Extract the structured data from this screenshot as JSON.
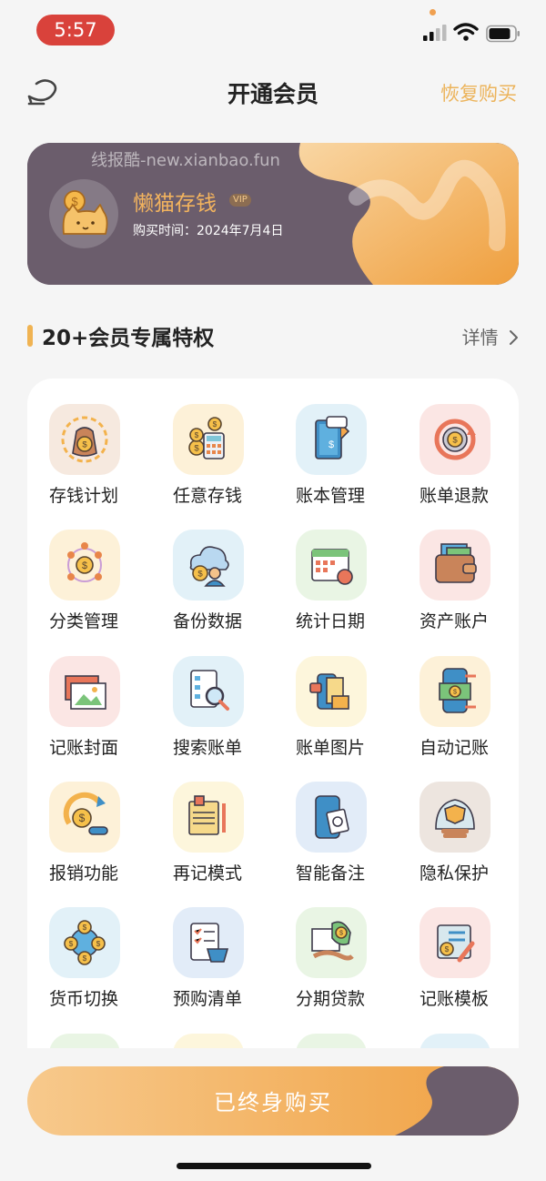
{
  "status_bar": {
    "time": "5:57"
  },
  "nav": {
    "title": "开通会员",
    "restore_label": "恢复购买"
  },
  "member_card": {
    "watermark": "线报酷-new.xianbao.fun",
    "name": "懒猫存钱",
    "vip_badge": "VIP",
    "purchase_time": "购买时间：2024年7月4日"
  },
  "section": {
    "title": "20+会员专属特权",
    "details_label": "详情"
  },
  "features": [
    {
      "label": "存钱计划",
      "icon": "money-bag-icon",
      "bg": "#f6e9df"
    },
    {
      "label": "任意存钱",
      "icon": "coins-calculator-icon",
      "bg": "#fdf1d8"
    },
    {
      "label": "账本管理",
      "icon": "ledger-book-icon",
      "bg": "#e2f1f8"
    },
    {
      "label": "账单退款",
      "icon": "refund-cycle-icon",
      "bg": "#fbe6e4"
    },
    {
      "label": "分类管理",
      "icon": "category-network-icon",
      "bg": "#fdf1d8"
    },
    {
      "label": "备份数据",
      "icon": "cloud-backup-icon",
      "bg": "#e2f1f8"
    },
    {
      "label": "统计日期",
      "icon": "calendar-stats-icon",
      "bg": "#e9f5e4"
    },
    {
      "label": "资产账户",
      "icon": "wallet-icon",
      "bg": "#fbe6e4"
    },
    {
      "label": "记账封面",
      "icon": "picture-cover-icon",
      "bg": "#fbe6e4"
    },
    {
      "label": "搜索账单",
      "icon": "search-document-icon",
      "bg": "#e2f1f8"
    },
    {
      "label": "账单图片",
      "icon": "receipt-photo-icon",
      "bg": "#fdf6dc"
    },
    {
      "label": "自动记账",
      "icon": "phone-transfer-icon",
      "bg": "#fdf1d8"
    },
    {
      "label": "报销功能",
      "icon": "reimburse-icon",
      "bg": "#fdf1d8"
    },
    {
      "label": "再记模式",
      "icon": "notes-pencil-icon",
      "bg": "#fdf6dc"
    },
    {
      "label": "智能备注",
      "icon": "smart-note-icon",
      "bg": "#e2ecf8"
    },
    {
      "label": "隐私保护",
      "icon": "privacy-shield-icon",
      "bg": "#ede5df"
    },
    {
      "label": "货币切换",
      "icon": "currency-exchange-icon",
      "bg": "#e2f1f8"
    },
    {
      "label": "预购清单",
      "icon": "shopping-list-icon",
      "bg": "#e2ecf8"
    },
    {
      "label": "分期贷款",
      "icon": "installment-loan-icon",
      "bg": "#e9f5e4"
    },
    {
      "label": "记账模板",
      "icon": "template-pen-icon",
      "bg": "#fbe6e4"
    }
  ],
  "partial_row_bgs": [
    "#e9f5e4",
    "#fdf6dc",
    "#e9f5e4",
    "#e2f1f8"
  ],
  "bottom": {
    "buy_label": "已终身购买"
  },
  "colors": {
    "accent": "#f0a54a",
    "card_dark": "#6b5d6c",
    "restore_text": "#ecb35a",
    "status_pill": "#d9423b"
  }
}
